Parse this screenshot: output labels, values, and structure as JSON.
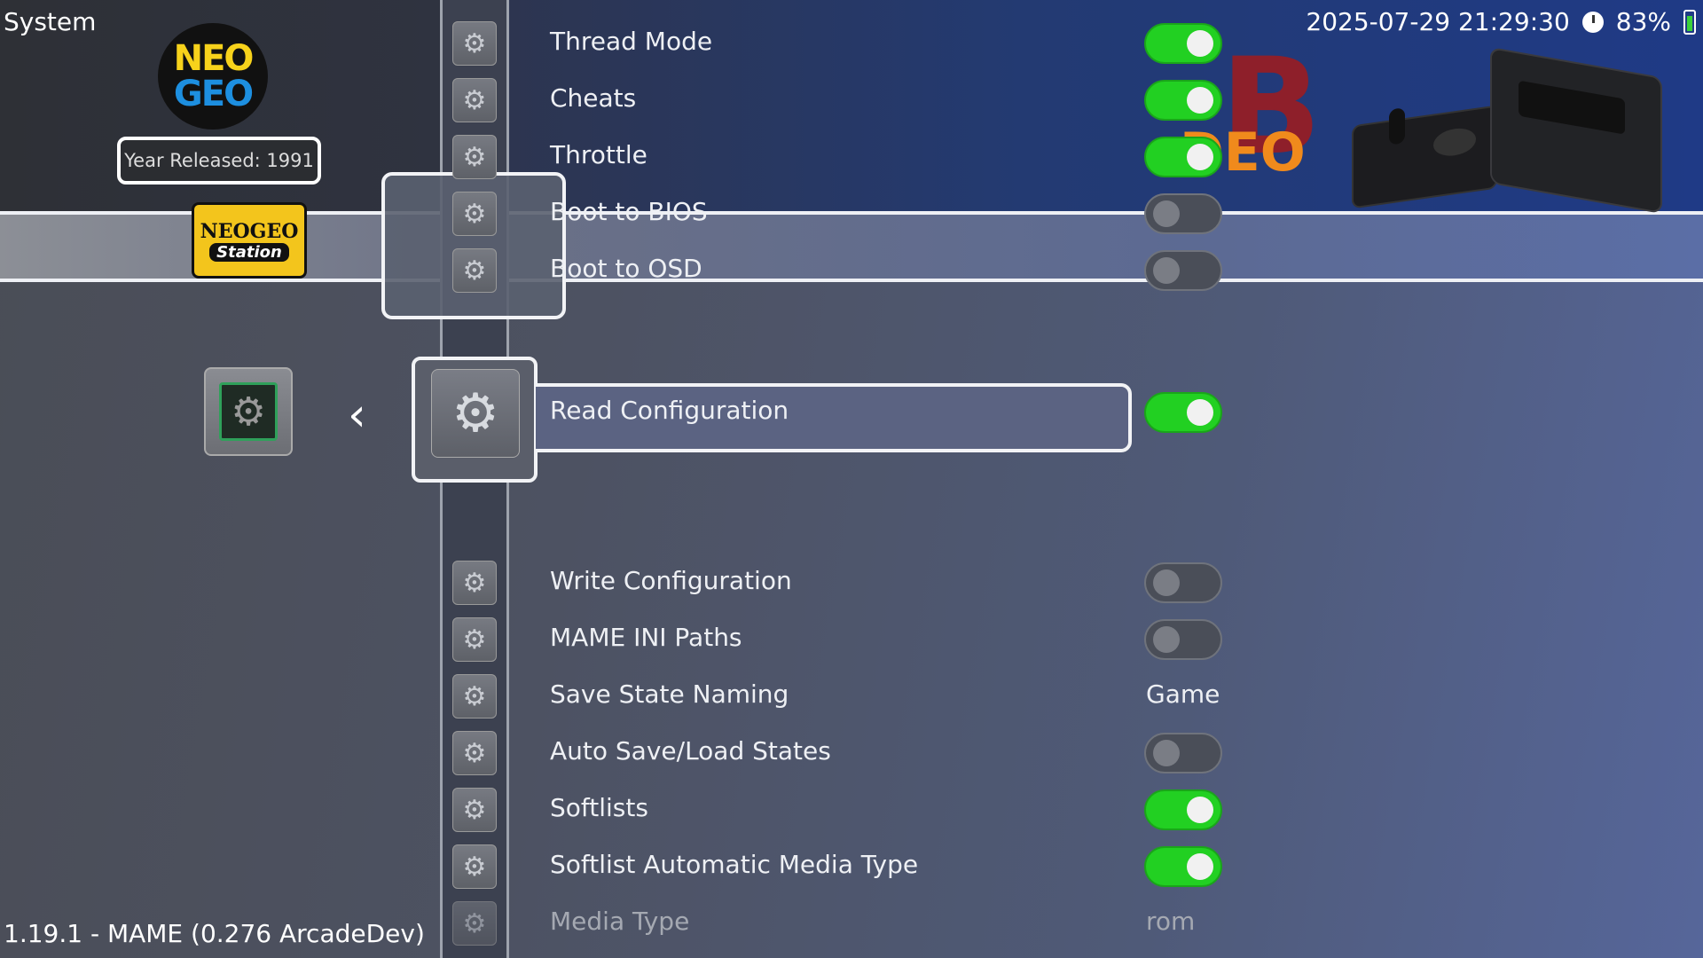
{
  "header": {
    "section_title": "System",
    "datetime": "2025-07-29 21:29:30",
    "battery": "83%"
  },
  "system": {
    "logo_text_top": "NEO",
    "logo_text_bottom": "GEO",
    "year_released": "Year Released: 1991",
    "station_logo_top": "NEOGEO",
    "station_logo_bottom": "Station"
  },
  "brand": {
    "letter": "B",
    "word": "DEO"
  },
  "settings": {
    "thread_mode": {
      "label": "Thread Mode",
      "enabled": true
    },
    "cheats": {
      "label": "Cheats",
      "enabled": true
    },
    "throttle": {
      "label": "Throttle",
      "enabled": true
    },
    "boot_to_bios": {
      "label": "Boot to BIOS",
      "enabled": false
    },
    "boot_to_osd": {
      "label": "Boot to OSD",
      "enabled": false
    },
    "read_configuration": {
      "label": "Read Configuration",
      "enabled": true
    },
    "write_configuration": {
      "label": "Write Configuration",
      "enabled": false
    },
    "mame_ini_paths": {
      "label": "MAME INI Paths",
      "enabled": false
    },
    "save_state_naming": {
      "label": "Save State Naming",
      "value": "Game"
    },
    "auto_save_load": {
      "label": "Auto Save/Load States",
      "enabled": false
    },
    "softlists": {
      "label": "Softlists",
      "enabled": true
    },
    "softlist_auto_media": {
      "label": "Softlist Automatic Media Type",
      "enabled": true
    },
    "media_type": {
      "label": "Media Type",
      "value": "rom"
    }
  },
  "footer": {
    "version": "1.19.1 - MAME (0.276 ArcadeDev)"
  },
  "icons": {
    "gear": "⚙",
    "chip": "⚙",
    "back": "‹"
  }
}
